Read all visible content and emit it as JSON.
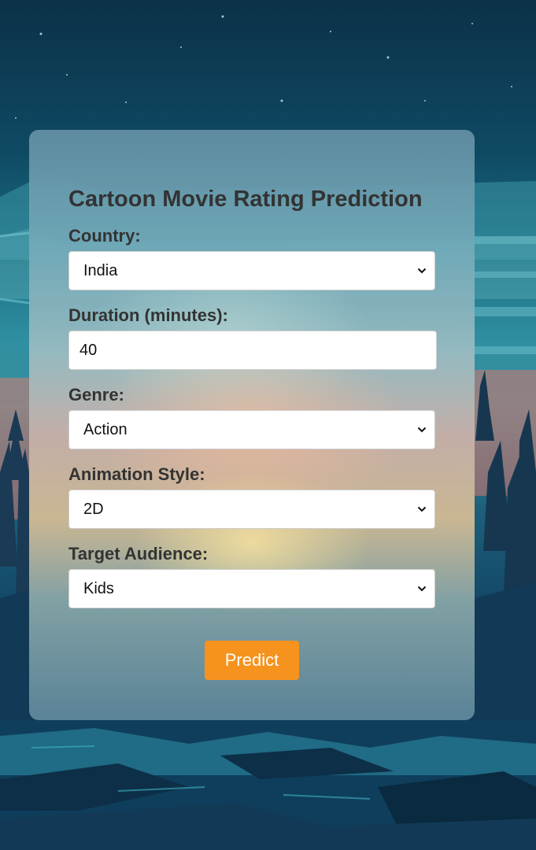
{
  "form": {
    "title": "Cartoon Movie Rating Prediction",
    "country": {
      "label": "Country:",
      "value": "India"
    },
    "duration": {
      "label": "Duration (minutes):",
      "value": "40"
    },
    "genre": {
      "label": "Genre:",
      "value": "Action"
    },
    "animation_style": {
      "label": "Animation Style:",
      "value": "2D"
    },
    "target_audience": {
      "label": "Target Audience:",
      "value": "Kids"
    },
    "submit_label": "Predict"
  },
  "theme": {
    "accent": "#f5931e",
    "text": "#333333"
  }
}
